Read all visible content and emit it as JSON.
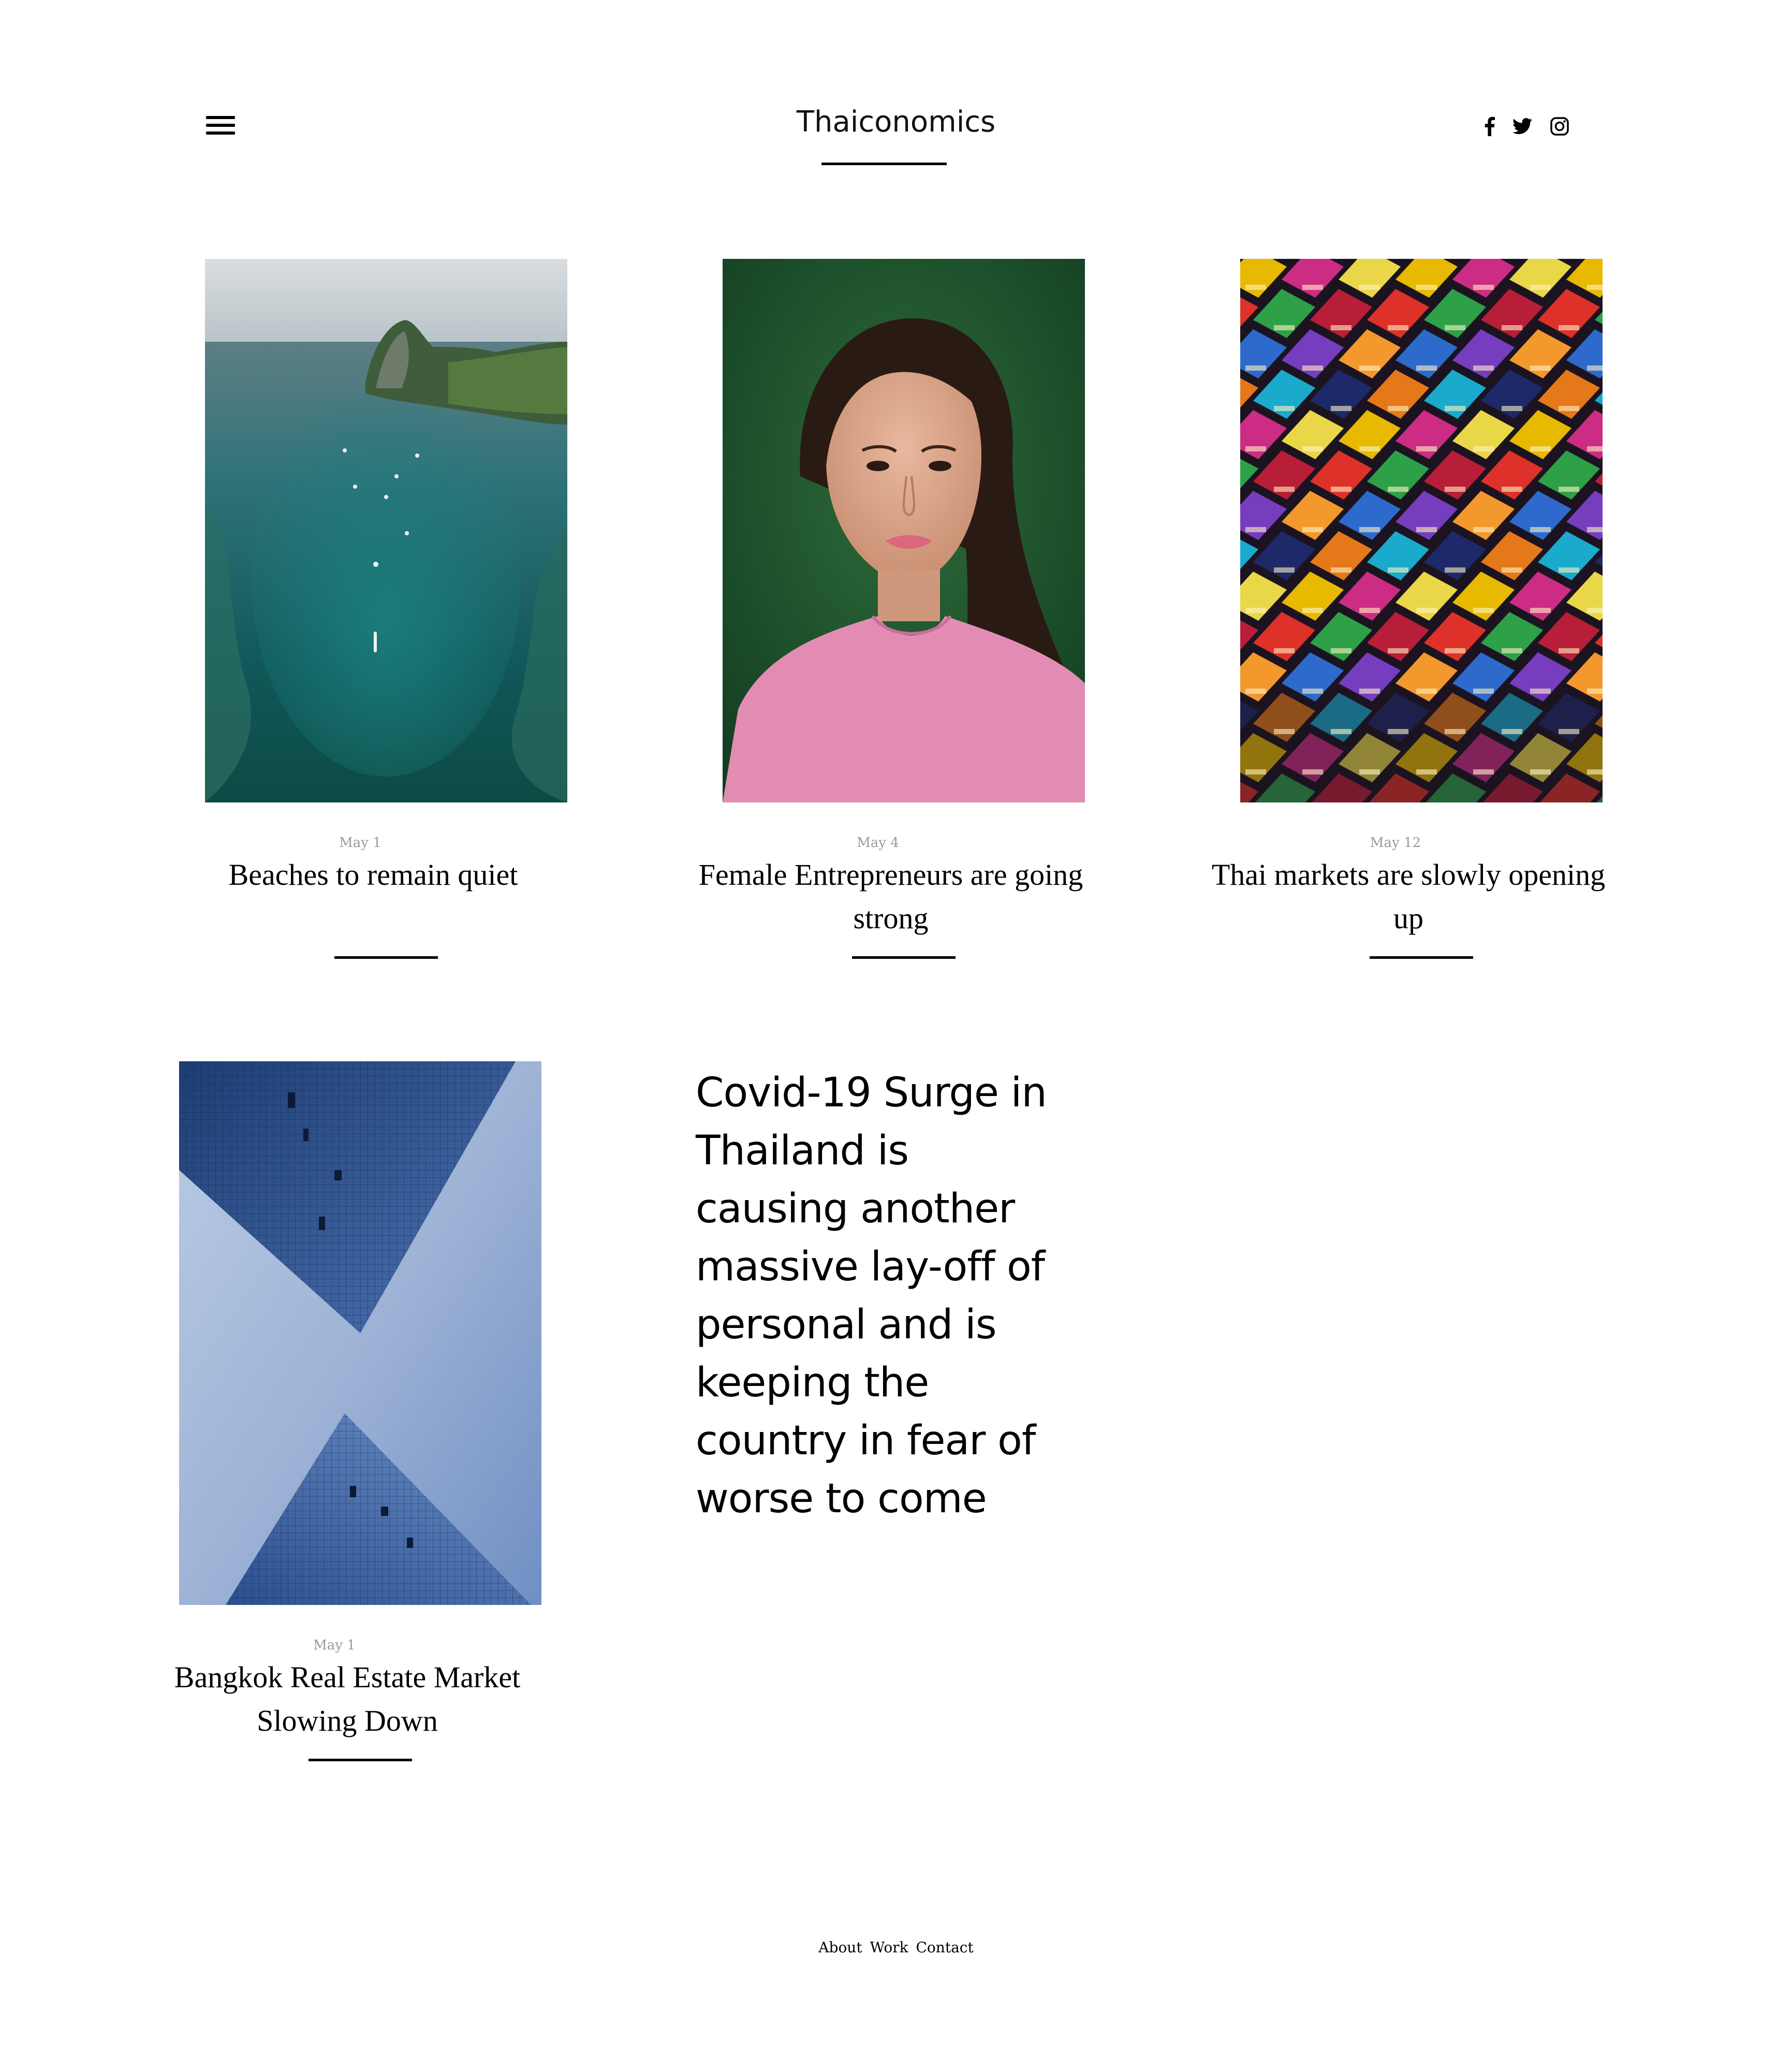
{
  "header": {
    "menu_icon": "hamburger-menu-icon",
    "site_title": "Thaiconomics",
    "social": [
      {
        "name": "facebook",
        "icon": "facebook-icon"
      },
      {
        "name": "twitter",
        "icon": "twitter-icon"
      },
      {
        "name": "instagram",
        "icon": "instagram-icon"
      }
    ]
  },
  "articles": [
    {
      "date": "May 1",
      "title": "Beaches to remain quiet",
      "image": "tropical-bay-aerial-photo"
    },
    {
      "date": "May 4",
      "title": "Female Entrepreneurs are going strong",
      "image": "woman-portrait-photo"
    },
    {
      "date": "May 12",
      "title": "Thai markets are slowly opening up",
      "image": "night-market-tents-photo"
    },
    {
      "date": "May 1",
      "title": "Bangkok Real Estate Market Slowing Down",
      "image": "skyscrapers-photo"
    }
  ],
  "feature": {
    "text": "Covid-19 Surge in Thailand is causing another massive lay-off of personal and is keeping the country in fear of worse to come"
  },
  "footer": {
    "links": [
      "About",
      "Work",
      "Contact"
    ]
  },
  "colors": {
    "background": "#ffffff",
    "text": "#000000",
    "date": "#9a9a9a"
  }
}
